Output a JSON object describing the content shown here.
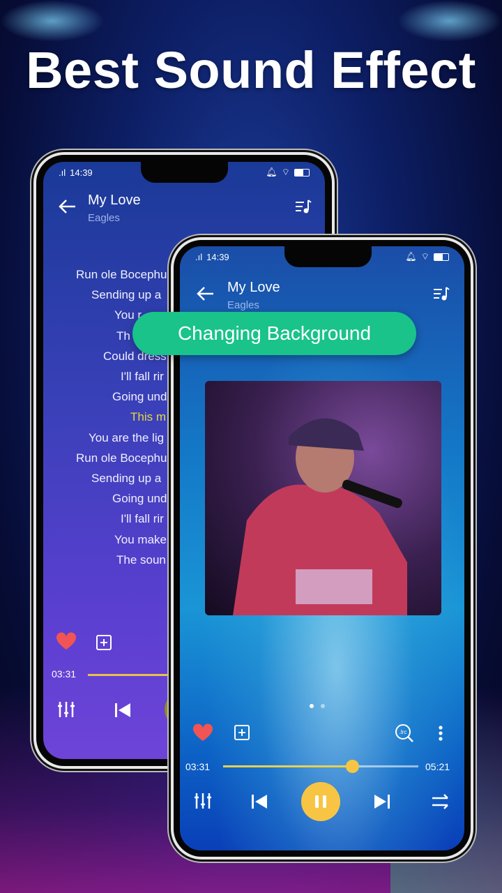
{
  "headline": "Best Sound Effect",
  "badge": "Changing Background",
  "status": {
    "time": "14:39"
  },
  "track": {
    "title": "My Love",
    "artist": "Eagles"
  },
  "back_phone": {
    "lyrics": [
      {
        "text": "Run ole Bocephu",
        "current": false
      },
      {
        "text": "Sending up a",
        "current": false
      },
      {
        "text": "You r",
        "current": false
      },
      {
        "text": "Th",
        "current": false
      },
      {
        "text": "Could dress",
        "current": false
      },
      {
        "text": "I'll fall rir",
        "current": false
      },
      {
        "text": "Going und",
        "current": false
      },
      {
        "text": "This m",
        "current": true
      },
      {
        "text": "You are the lig",
        "current": false
      },
      {
        "text": "Run ole Bocephu",
        "current": false
      },
      {
        "text": "Sending up a",
        "current": false
      },
      {
        "text": "Going und",
        "current": false
      },
      {
        "text": "I'll fall rir",
        "current": false
      },
      {
        "text": "You make",
        "current": false
      },
      {
        "text": "The soun",
        "current": false
      }
    ],
    "elapsed": "03:31"
  },
  "front_phone": {
    "elapsed": "03:31",
    "duration": "05:21",
    "progress": 0.66,
    "page_dots": 2,
    "active_page": 0
  },
  "colors": {
    "accent": "#f7c543",
    "heart": "#f05454",
    "badge": "#19c38a",
    "current_lyric": "#e6d93a"
  }
}
